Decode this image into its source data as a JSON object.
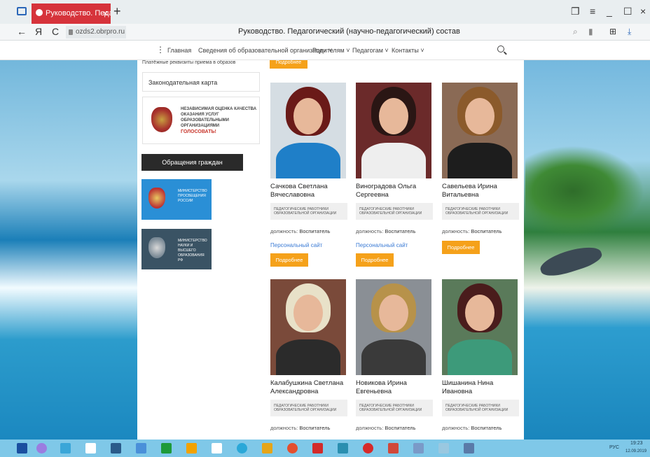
{
  "browser": {
    "tab_title": "Руководство. Педагогич",
    "tab_close": "×",
    "new_tab": "+",
    "url": "ozds2.obrpro.ru",
    "page_title": "Руководство. Педагогический (научно-педагогический) состав",
    "nav_back": "←",
    "nav_yandex": "Я",
    "nav_reload": "C",
    "win_buttons": [
      "≡",
      "_",
      "☐",
      "×"
    ]
  },
  "site_nav": {
    "menu_icon": "⋮",
    "items": [
      "Главная",
      "Сведения об образовательной организации ˅",
      "Родителям ˅",
      "Педагогам ˅",
      "Контакты ˅"
    ]
  },
  "sidebar": {
    "cut_link": "Платёжные реквизиты приема в образов",
    "law_map": "Законодательная карта",
    "banner_text": "НЕЗАВИСИМАЯ ОЦЕНКА КАЧЕСТВА ОКАЗАНИЯ УСЛУГ ОБРАЗОВАТЕЛЬНЫМИ ОРГАНИЗАЦИЯМИ",
    "banner_vote": "ГОЛОСОВАТЬ!",
    "citizens_button": "Обращения граждан",
    "ministry_1": "МИНИСТЕРСТВО ПРОСВЕЩЕНИЯ РОССИИ",
    "ministry_2": "МИНИСТЕРСТВО НАУКИ И ВЫСШЕГО ОБРАЗОВАНИЯ РФ"
  },
  "staff_common": {
    "category": "ПЕДАГОГИЧЕСКИЕ РАБОТНИКИ ОБРАЗОВАТЕЛЬНОЙ ОРГАНИЗАЦИИ",
    "position_label": "должность:",
    "position_value": "Воспитатель",
    "personal_site": "Персональный сайт",
    "more_button": "Подробнее"
  },
  "staff": [
    {
      "name": "Сачкова Светлана Вячеславовна",
      "has_site": true
    },
    {
      "name": "Виноградова Ольга Сергеевна",
      "has_site": true
    },
    {
      "name": "Савельева Ирина Витальевна",
      "has_site": false
    },
    {
      "name": "Калабушкина Светлана Александровна",
      "has_site": false
    },
    {
      "name": "Новикова Ирина Евгеньевна",
      "has_site": false
    },
    {
      "name": "Шишанина Нина Ивановна",
      "has_site": false
    }
  ],
  "taskbar": {
    "tray_lang": "РУС",
    "tray_time": "19:23",
    "tray_date": "12.09.2019"
  }
}
